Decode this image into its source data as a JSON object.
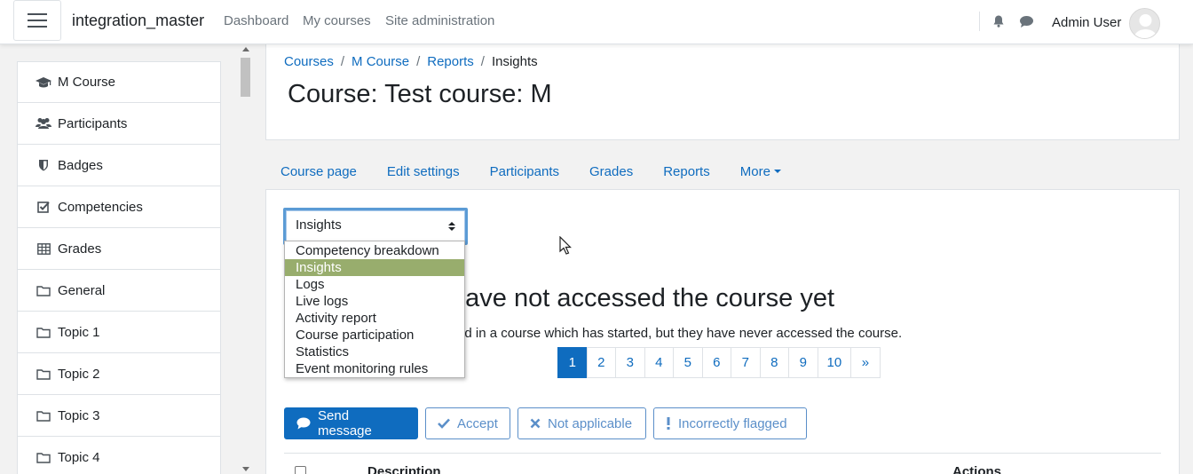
{
  "navbar": {
    "site_name": "integration_master",
    "links": [
      "Dashboard",
      "My courses",
      "Site administration"
    ],
    "user_name": "Admin User",
    "icons": [
      "bell-icon",
      "chat-icon"
    ]
  },
  "drawer": {
    "items": [
      {
        "label": "M Course",
        "icon": "graduation-cap-icon"
      },
      {
        "label": "Participants",
        "icon": "users-icon"
      },
      {
        "label": "Badges",
        "icon": "shield-icon"
      },
      {
        "label": "Competencies",
        "icon": "check-square-icon"
      },
      {
        "label": "Grades",
        "icon": "table-icon"
      },
      {
        "label": "General",
        "icon": "folder-icon"
      },
      {
        "label": "Topic 1",
        "icon": "folder-icon"
      },
      {
        "label": "Topic 2",
        "icon": "folder-icon"
      },
      {
        "label": "Topic 3",
        "icon": "folder-icon"
      },
      {
        "label": "Topic 4",
        "icon": "folder-icon"
      }
    ]
  },
  "header": {
    "breadcrumb": [
      "Courses",
      "M Course",
      "Reports",
      "Insights"
    ],
    "title": "Course: Test course: M"
  },
  "secondary_nav": {
    "items": [
      "Course page",
      "Edit settings",
      "Participants",
      "Grades",
      "Reports",
      "More"
    ]
  },
  "report_select": {
    "value": "Insights",
    "options": [
      "Competency breakdown",
      "Insights",
      "Logs",
      "Live logs",
      "Activity report",
      "Course participation",
      "Statistics",
      "Event monitoring rules"
    ],
    "selected_index": 1,
    "selected_color": "#98ad6d"
  },
  "insight": {
    "title_visible": "have not accessed the course yet",
    "description_visible": "olled in a course which has started, but they have never accessed the course."
  },
  "pagination": {
    "pages": [
      "1",
      "2",
      "3",
      "4",
      "5",
      "6",
      "7",
      "8",
      "9",
      "10",
      "»"
    ],
    "active": "1"
  },
  "actions": {
    "send_message": "Send message",
    "accept": "Accept",
    "not_applicable": "Not applicable",
    "incorrectly_flagged": "Incorrectly flagged"
  },
  "table": {
    "headers": [
      "Description",
      "Actions"
    ]
  },
  "colors": {
    "primary": "#0f6cbf",
    "outline": "#5b8fc9"
  }
}
